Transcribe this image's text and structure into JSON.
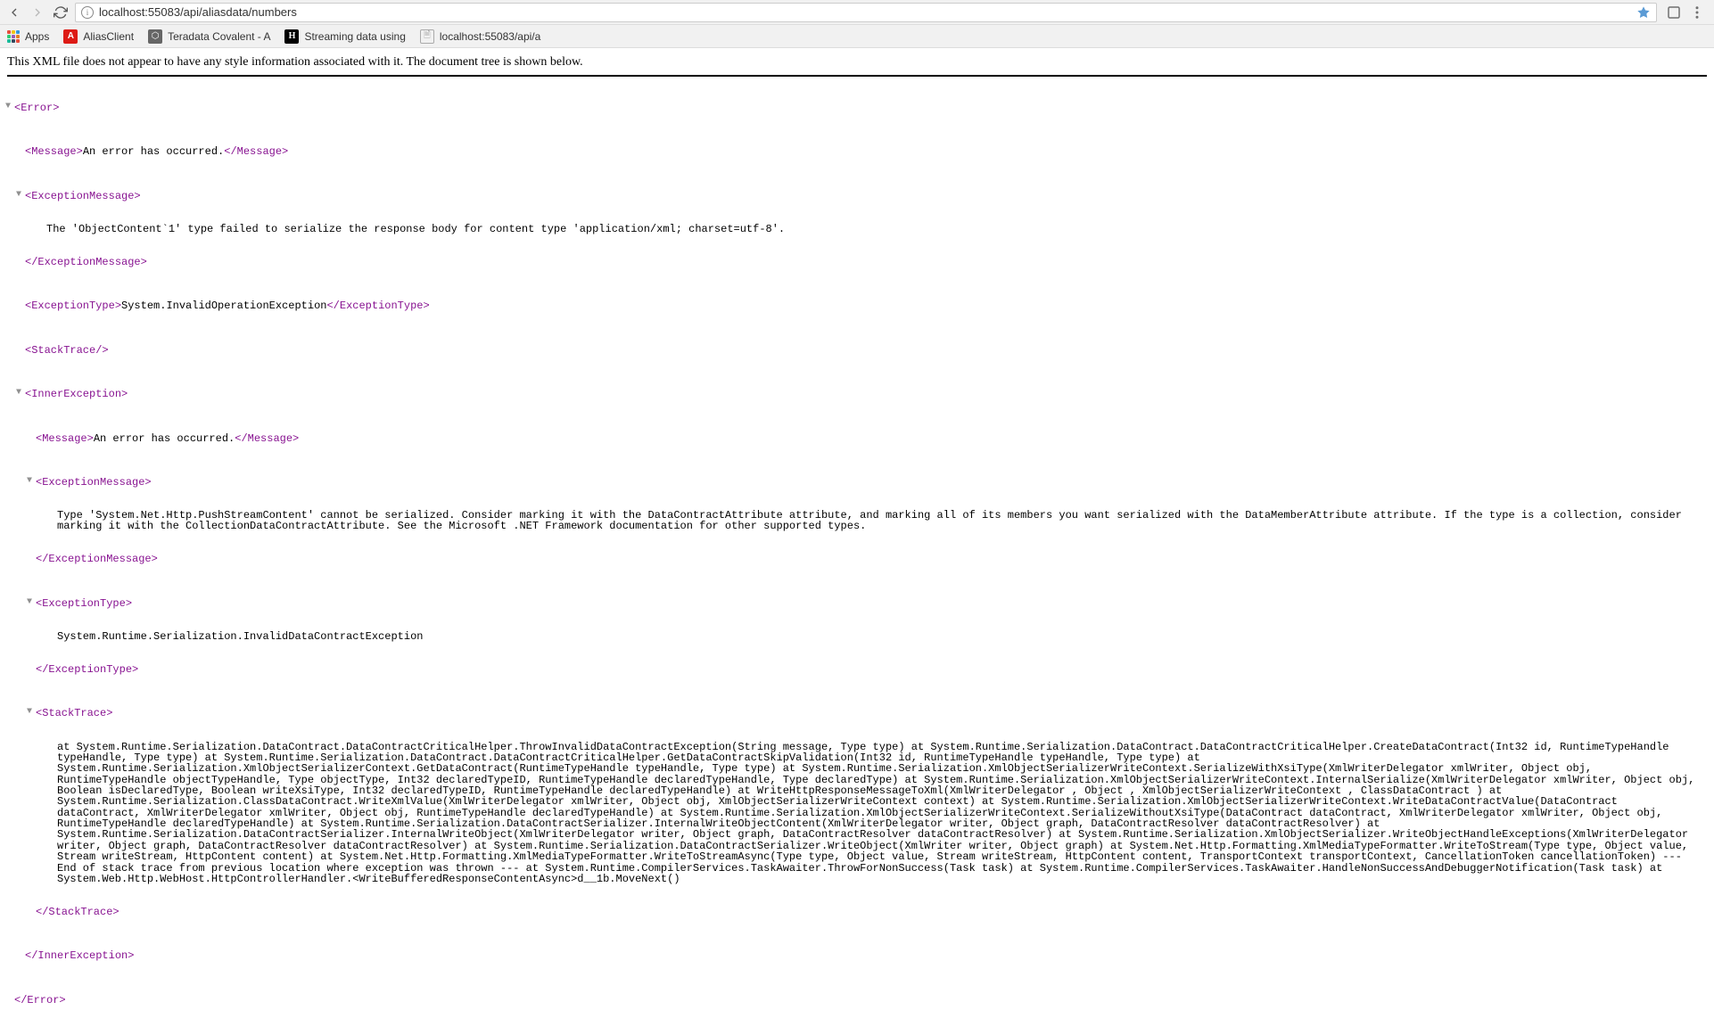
{
  "browser": {
    "url": "localhost:55083/api/aliasdata/numbers"
  },
  "bookmarks": {
    "apps_label": "Apps",
    "items": [
      {
        "label": "AliasClient",
        "icon": "angular"
      },
      {
        "label": "Teradata Covalent - A",
        "icon": "covalent"
      },
      {
        "label": "Streaming data using",
        "icon": "hackernoon"
      },
      {
        "label": "localhost:55083/api/a",
        "icon": "doc"
      }
    ]
  },
  "notice": "This XML file does not appear to have any style information associated with it. The document tree is shown below.",
  "xml": {
    "error_open": "<Error>",
    "error_close": "</Error>",
    "message_open": "<Message>",
    "message_close": "</Message>",
    "message_text": "An error has occurred.",
    "exception_message_open": "<ExceptionMessage>",
    "exception_message_close": "</ExceptionMessage>",
    "exception_message_text": "The 'ObjectContent`1' type failed to serialize the response body for content type 'application/xml; charset=utf-8'.",
    "exception_type_open": "<ExceptionType>",
    "exception_type_close": "</ExceptionType>",
    "exception_type_text": "System.InvalidOperationException",
    "stack_trace_self": "<StackTrace/>",
    "inner_exception_open": "<InnerException>",
    "inner_exception_close": "</InnerException>",
    "inner_message_text": "An error has occurred.",
    "inner_exception_message_text": "Type 'System.Net.Http.PushStreamContent' cannot be serialized. Consider marking it with the DataContractAttribute attribute, and marking all of its members you want serialized with the DataMemberAttribute attribute. If the type is a collection, consider marking it with the CollectionDataContractAttribute. See the Microsoft .NET Framework documentation for other supported types.",
    "inner_exception_type_text": "System.Runtime.Serialization.InvalidDataContractException",
    "stack_trace_open": "<StackTrace>",
    "stack_trace_close": "</StackTrace>",
    "stack_trace_text": "at System.Runtime.Serialization.DataContract.DataContractCriticalHelper.ThrowInvalidDataContractException(String message, Type type) at System.Runtime.Serialization.DataContract.DataContractCriticalHelper.CreateDataContract(Int32 id, RuntimeTypeHandle typeHandle, Type type) at System.Runtime.Serialization.DataContract.DataContractCriticalHelper.GetDataContractSkipValidation(Int32 id, RuntimeTypeHandle typeHandle, Type type) at System.Runtime.Serialization.XmlObjectSerializerContext.GetDataContract(RuntimeTypeHandle typeHandle, Type type) at System.Runtime.Serialization.XmlObjectSerializerWriteContext.SerializeWithXsiType(XmlWriterDelegator xmlWriter, Object obj, RuntimeTypeHandle objectTypeHandle, Type objectType, Int32 declaredTypeID, RuntimeTypeHandle declaredTypeHandle, Type declaredType) at System.Runtime.Serialization.XmlObjectSerializerWriteContext.InternalSerialize(XmlWriterDelegator xmlWriter, Object obj, Boolean isDeclaredType, Boolean writeXsiType, Int32 declaredTypeID, RuntimeTypeHandle declaredTypeHandle) at WriteHttpResponseMessageToXml(XmlWriterDelegator , Object , XmlObjectSerializerWriteContext , ClassDataContract ) at System.Runtime.Serialization.ClassDataContract.WriteXmlValue(XmlWriterDelegator xmlWriter, Object obj, XmlObjectSerializerWriteContext context) at System.Runtime.Serialization.XmlObjectSerializerWriteContext.WriteDataContractValue(DataContract dataContract, XmlWriterDelegator xmlWriter, Object obj, RuntimeTypeHandle declaredTypeHandle) at System.Runtime.Serialization.XmlObjectSerializerWriteContext.SerializeWithoutXsiType(DataContract dataContract, XmlWriterDelegator xmlWriter, Object obj, RuntimeTypeHandle declaredTypeHandle) at System.Runtime.Serialization.DataContractSerializer.InternalWriteObjectContent(XmlWriterDelegator writer, Object graph, DataContractResolver dataContractResolver) at System.Runtime.Serialization.DataContractSerializer.InternalWriteObject(XmlWriterDelegator writer, Object graph, DataContractResolver dataContractResolver) at System.Runtime.Serialization.XmlObjectSerializer.WriteObjectHandleExceptions(XmlWriterDelegator writer, Object graph, DataContractResolver dataContractResolver) at System.Runtime.Serialization.DataContractSerializer.WriteObject(XmlWriter writer, Object graph) at System.Net.Http.Formatting.XmlMediaTypeFormatter.WriteToStream(Type type, Object value, Stream writeStream, HttpContent content) at System.Net.Http.Formatting.XmlMediaTypeFormatter.WriteToStreamAsync(Type type, Object value, Stream writeStream, HttpContent content, TransportContext transportContext, CancellationToken cancellationToken) --- End of stack trace from previous location where exception was thrown --- at System.Runtime.CompilerServices.TaskAwaiter.ThrowForNonSuccess(Task task) at System.Runtime.CompilerServices.TaskAwaiter.HandleNonSuccessAndDebuggerNotification(Task task) at System.Web.Http.WebHost.HttpControllerHandler.<WriteBufferedResponseContentAsync>d__1b.MoveNext()"
  }
}
